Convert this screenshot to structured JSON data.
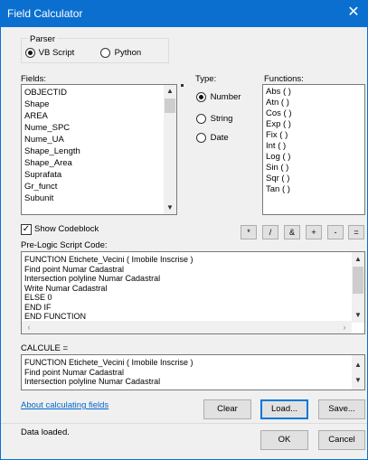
{
  "window": {
    "title": "Field Calculator",
    "close_glyph": "✕",
    "accent_color": "#0b6fd0"
  },
  "parser": {
    "label": "Parser",
    "options": [
      {
        "label": "VB Script",
        "selected": true
      },
      {
        "label": "Python",
        "selected": false
      }
    ]
  },
  "fields": {
    "label": "Fields:",
    "items": [
      "OBJECTID",
      "Shape",
      "AREA",
      "Nume_SPC",
      "Nume_UA",
      "Shape_Length",
      "Shape_Area",
      "Suprafata",
      "Gr_funct",
      "Subunit"
    ]
  },
  "type": {
    "label": "Type:",
    "options": [
      {
        "label": "Number",
        "selected": true
      },
      {
        "label": "String",
        "selected": false
      },
      {
        "label": "Date",
        "selected": false
      }
    ]
  },
  "functions": {
    "label": "Functions:",
    "items": [
      "Abs ( )",
      "Atn ( )",
      "Cos ( )",
      "Exp ( )",
      "Fix ( )",
      "Int ( )",
      "Log ( )",
      "Sin ( )",
      "Sqr ( )",
      "Tan ( )"
    ]
  },
  "show_codeblock": {
    "label": "Show Codeblock",
    "checked": true
  },
  "operators": [
    "*",
    "/",
    "&",
    "+",
    "-",
    "="
  ],
  "prelogic": {
    "label": "Pre-Logic Script Code:",
    "lines": [
      "FUNCTION Etichete_Vecini ( Imobile Inscrise )",
      "Find point Numar Cadastral",
      "Intersection polyline Numar Cadastral",
      "Write Numar Cadastral",
      "ELSE 0",
      "END IF",
      "END FUNCTION"
    ]
  },
  "calcule": {
    "label": "CALCULE =",
    "lines": [
      "FUNCTION Etichete_Vecini ( Imobile Inscrise )",
      "Find point Numar Cadastral",
      "Intersection polyline Numar Cadastral"
    ]
  },
  "help_link": "About calculating fields",
  "buttons": {
    "clear": "Clear",
    "load": "Load...",
    "save": "Save...",
    "ok": "OK",
    "cancel": "Cancel"
  },
  "status": "Data loaded."
}
